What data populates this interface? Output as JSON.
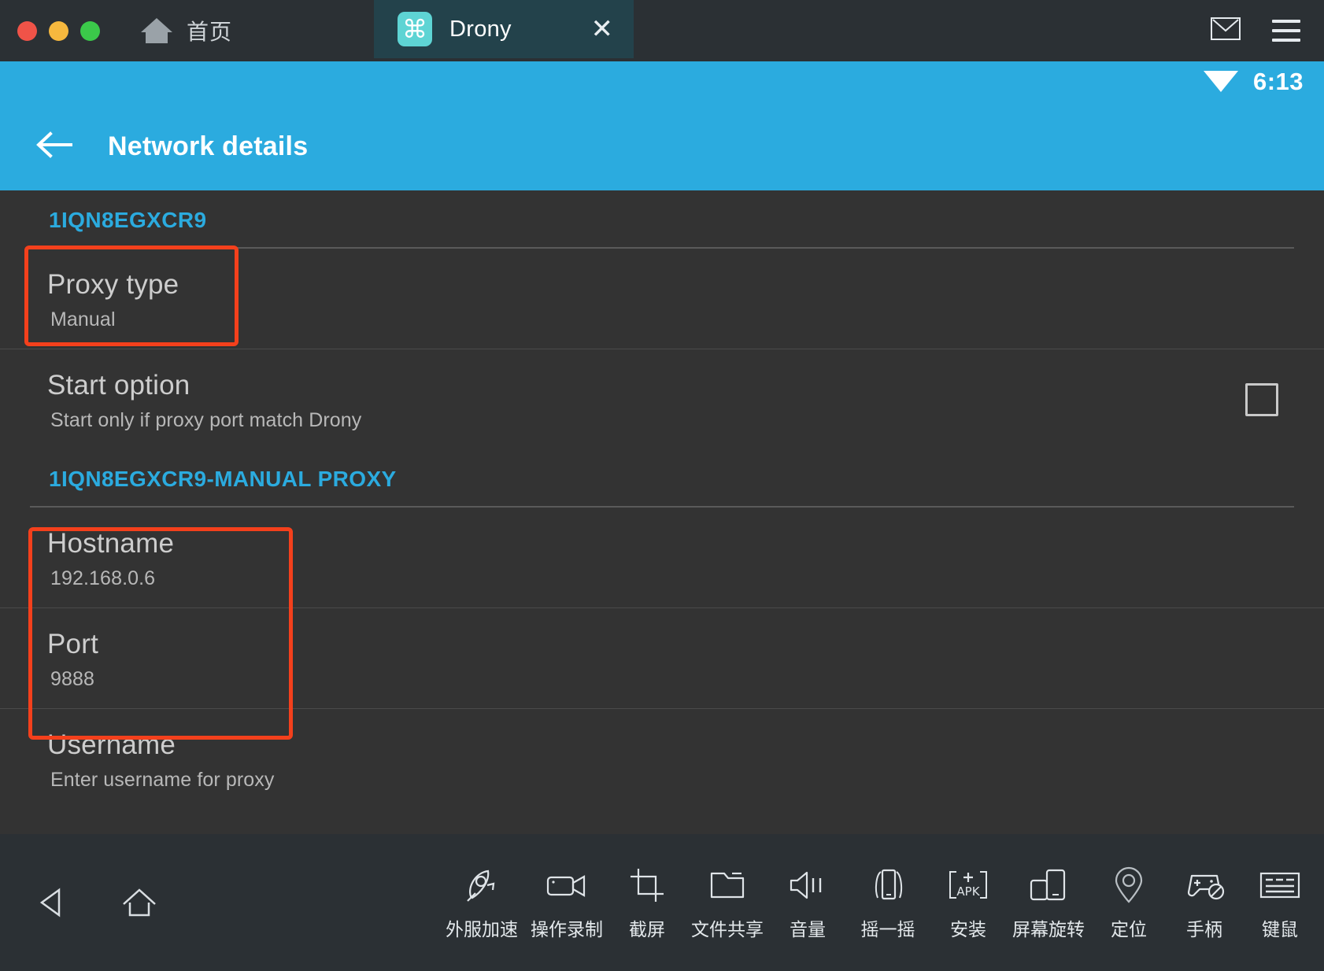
{
  "window": {
    "home_label": "首页",
    "tab": {
      "title": "Drony",
      "icon": "command-icon",
      "close": "✕"
    },
    "right_icons": [
      "mail-icon",
      "menu-icon"
    ]
  },
  "status_bar": {
    "time": "6:13",
    "wifi": "wifi-icon"
  },
  "app_bar": {
    "title": "Network details",
    "back": "back-arrow-icon"
  },
  "content": {
    "sections": [
      {
        "header": "1IQN8EGXCR9",
        "rows": [
          {
            "title": "Proxy type",
            "sub": "Manual",
            "checkbox": false,
            "highlighted": true
          },
          {
            "title": "Start option",
            "sub": "Start only if proxy port match Drony",
            "checkbox": true,
            "checked": false,
            "highlighted": false
          }
        ]
      },
      {
        "header": "1IQN8EGXCR9-MANUAL PROXY",
        "rows": [
          {
            "title": "Hostname",
            "sub": "192.168.0.6",
            "checkbox": false,
            "highlighted": true
          },
          {
            "title": "Port",
            "sub": "9888",
            "checkbox": false,
            "highlighted": true
          },
          {
            "title": "Username",
            "sub": "Enter username for proxy",
            "checkbox": false,
            "highlighted": false
          }
        ]
      }
    ]
  },
  "bottom_bar": {
    "nav": [
      {
        "name": "back-nav-icon"
      },
      {
        "name": "home-nav-icon"
      }
    ],
    "tools": [
      {
        "icon": "rocket-icon",
        "label": "外服加速"
      },
      {
        "icon": "video-camera-icon",
        "label": "操作录制"
      },
      {
        "icon": "crop-icon",
        "label": "截屏"
      },
      {
        "icon": "folder-icon",
        "label": "文件共享"
      },
      {
        "icon": "volume-icon",
        "label": "音量"
      },
      {
        "icon": "shake-icon",
        "label": "摇一摇"
      },
      {
        "icon": "apk-install-icon",
        "label": "安装"
      },
      {
        "icon": "rotate-screen-icon",
        "label": "屏幕旋转"
      },
      {
        "icon": "location-pin-icon",
        "label": "定位"
      },
      {
        "icon": "gamepad-icon",
        "label": "手柄"
      },
      {
        "icon": "keyboard-icon",
        "label": "键鼠"
      }
    ]
  },
  "colors": {
    "accent_blue": "#2babdf",
    "highlight_red": "#f4401c",
    "content_bg": "#333333",
    "chrome_bg": "#2b3034",
    "tab_bg": "#23424b",
    "app_icon_bg": "#5ed4d4"
  }
}
